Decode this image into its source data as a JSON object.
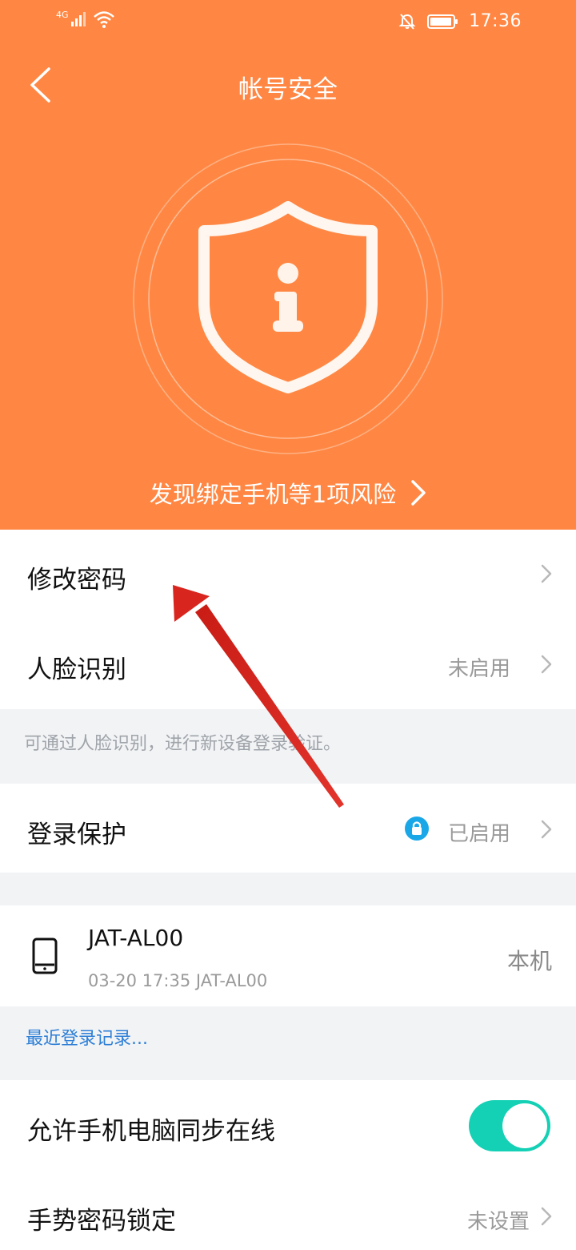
{
  "status_bar": {
    "network": "4G",
    "time": "17:36"
  },
  "nav": {
    "title": "帐号安全"
  },
  "risk_banner": {
    "text": "发现绑定手机等1项风险"
  },
  "items": {
    "change_password": {
      "label": "修改密码"
    },
    "face_id": {
      "label": "人脸识别",
      "value": "未启用"
    },
    "face_hint": "可通过人脸识别，进行新设备登录验证。",
    "login_protect": {
      "label": "登录保护",
      "value": "已启用"
    },
    "device": {
      "name": "JAT-AL00",
      "detail": "03-20 17:35 JAT-AL00",
      "tag": "本机"
    },
    "recent_login_link": "最近登录记录...",
    "sync_online": {
      "label": "允许手机电脑同步在线",
      "enabled": true
    },
    "gesture_lock": {
      "label": "手势密码锁定",
      "value": "未设置"
    }
  },
  "colors": {
    "header": "#ff8743",
    "toggle_on": "#14d0b5",
    "link": "#2d7fd6",
    "lock_badge": "#1aa7e8",
    "annotation_arrow": "#d8261f"
  }
}
